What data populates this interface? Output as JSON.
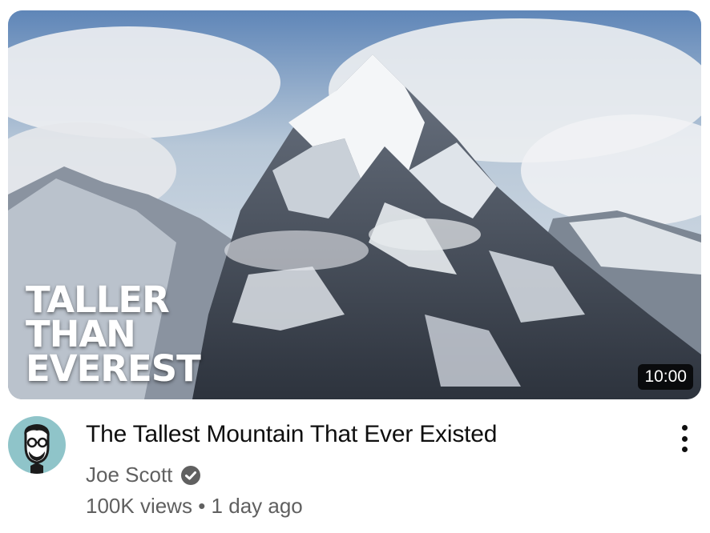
{
  "video": {
    "thumbnail_text": [
      "TALLER",
      "THAN",
      "EVEREST"
    ],
    "duration": "10:00",
    "title": "The Tallest Mountain That Ever Existed",
    "channel": "Joe Scott",
    "views": "100K views",
    "separator": "•",
    "age": "1 day ago"
  },
  "icons": {
    "verified": "verified-check-icon",
    "menu": "more-vert-icon",
    "avatar": "channel-avatar"
  },
  "colors": {
    "title": "#0f0f0f",
    "secondary": "#606060",
    "avatar_bg": "#8fc4c9",
    "duration_bg": "#000000"
  }
}
